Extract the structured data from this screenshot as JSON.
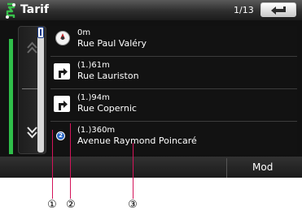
{
  "header": {
    "title": "Tarif",
    "title_icon": "route-info-icon",
    "page_counter": "1/13",
    "back_icon": "back-arrow-icon"
  },
  "scroll": {
    "up_icon": "double-chevron-up-icon",
    "down_icon": "double-chevron-down-icon",
    "thumb_label": "I"
  },
  "route": {
    "line_color": "#2fbf4a",
    "rows": [
      {
        "distance": "0m",
        "street": "Rue Paul Valéry",
        "icon": "compass-icon"
      },
      {
        "distance": "(1.)61m",
        "street": "Rue Lauriston",
        "icon": "turn-right-icon"
      },
      {
        "distance": "(1.)94m",
        "street": "Rue Copernic",
        "icon": "turn-right-icon"
      },
      {
        "distance": "(1.)360m",
        "street": "Avenue Raymond Poincaré",
        "icon": "destination-marker-icon"
      }
    ]
  },
  "bottom": {
    "mod_label": "Mod"
  },
  "callouts": {
    "c1": "①",
    "c2": "②",
    "c3": "③",
    "leader_color": "#d4145a"
  }
}
